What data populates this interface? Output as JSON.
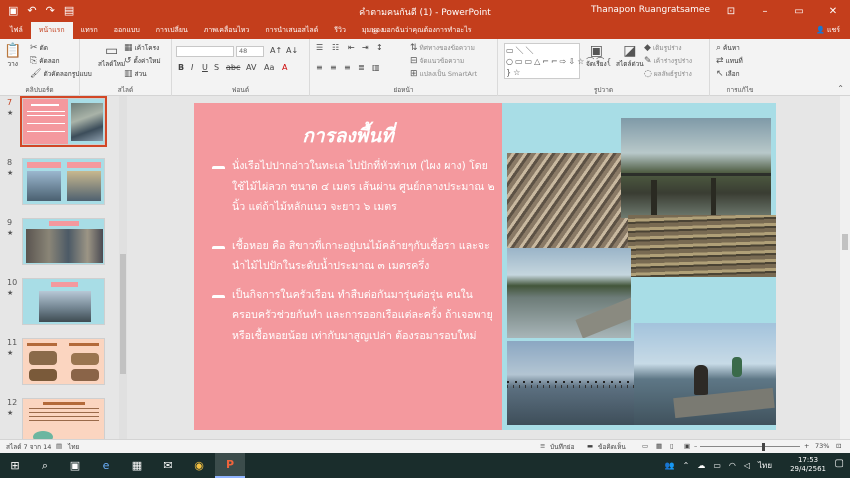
{
  "titlebar": {
    "doc_title": "คำตามคนกันดี (1) - PowerPoint",
    "user": "Thanapon Ruangratsamee",
    "qat": [
      "save-icon",
      "undo-icon",
      "redo-icon",
      "present-icon"
    ],
    "win": [
      "⊡",
      "–",
      "▭",
      "✕"
    ]
  },
  "tabs": [
    "ไฟล์",
    "หน้าแรก",
    "แทรก",
    "ออกแบบ",
    "การเปลี่ยน",
    "ภาพเคลื่อนไหว",
    "การนำเสนอสไลด์",
    "รีวิว",
    "มุมมอง"
  ],
  "tell_me": "บอกฉันว่าคุณต้องการทำอะไร",
  "share": "แชร์",
  "ribbon": {
    "clipboard": {
      "label": "คลิปบอร์ด",
      "paste": "วาง",
      "cut": "ตัด",
      "copy": "คัดลอก",
      "format_painter": "ตัวคัดลอกรูปแบบ"
    },
    "slides": {
      "label": "สไลด์",
      "new_slide": "สไลด์ใหม่",
      "layout": "เค้าโครง",
      "reset": "ตั้งค่าใหม่",
      "section": "ส่วน"
    },
    "font": {
      "label": "ฟอนต์",
      "font_name": "",
      "font_size": "48"
    },
    "paragraph": {
      "label": "ย่อหน้า",
      "text_direction": "ทิศทางของข้อความ",
      "align_text": "จัดแนวข้อความ",
      "smartart": "แปลงเป็น SmartArt"
    },
    "drawing": {
      "label": "รูปวาด",
      "arrange": "จัดเรียง",
      "quick_styles": "สไตล์ด่วน",
      "fill": "เติมรูปร่าง",
      "outline": "เค้าร่างรูปร่าง",
      "effects": "ผลลัพธ์รูปร่าง"
    },
    "editing": {
      "label": "การแก้ไข",
      "find": "ค้นหา",
      "replace": "แทนที่",
      "select": "เลือก"
    }
  },
  "slides_panel": [
    {
      "num": "7",
      "star": "★"
    },
    {
      "num": "8",
      "star": "★"
    },
    {
      "num": "9",
      "star": "★"
    },
    {
      "num": "10",
      "star": "★"
    },
    {
      "num": "11",
      "star": "★"
    },
    {
      "num": "12",
      "star": "★"
    }
  ],
  "slide": {
    "title": "การลงพื้นที่",
    "bullets": [
      "นั่งเรือไปปากอ่าวในทะเล ไปปักที่หัวท่าเท (ไผง ผาง) โดยใช้ไม้ไผ่ลวก ขนาด ๔ เมตร เส้นผ่าน ศูนย์กลางประมาณ ๒ นิ้ว แต่ถ้าไม้หลักแนว จะยาว ๖ เมตร",
      "เชื้อหอย คือ สิขาวที่เกาะอยู่บนไม้คล้ายๆกับเชื้อรา และจะนำไม้ไปปักในระดับน้ำประมาณ ๓ เมตรครึ่ง",
      "เป็นกิจการในครัวเรือน ทำสืบต่อกันมารุ่นต่อรุ่น คนในครอบครัวช่วยกันทำ และการออกเรือแต่ละครั้ง ถ้าเจอพายุ หรือเชื้อหอยน้อย เท่ากับมาสูญเปล่า ต้องรอมารอบใหม่"
    ]
  },
  "status": {
    "slide_of": "สไลด์ 7 จาก 14",
    "language": "ไทย",
    "notes": "บันทึกย่อ",
    "comments": "ข้อคิดเห็น",
    "zoom": "73%"
  },
  "taskbar": {
    "apps": [
      "start-icon",
      "search-icon",
      "task-view-icon",
      "edge-icon",
      "store-icon",
      "mail-icon",
      "chrome-icon",
      "powerpoint-icon"
    ],
    "lang": "ไทย",
    "time": "17:53",
    "date": "29/4/2561"
  }
}
